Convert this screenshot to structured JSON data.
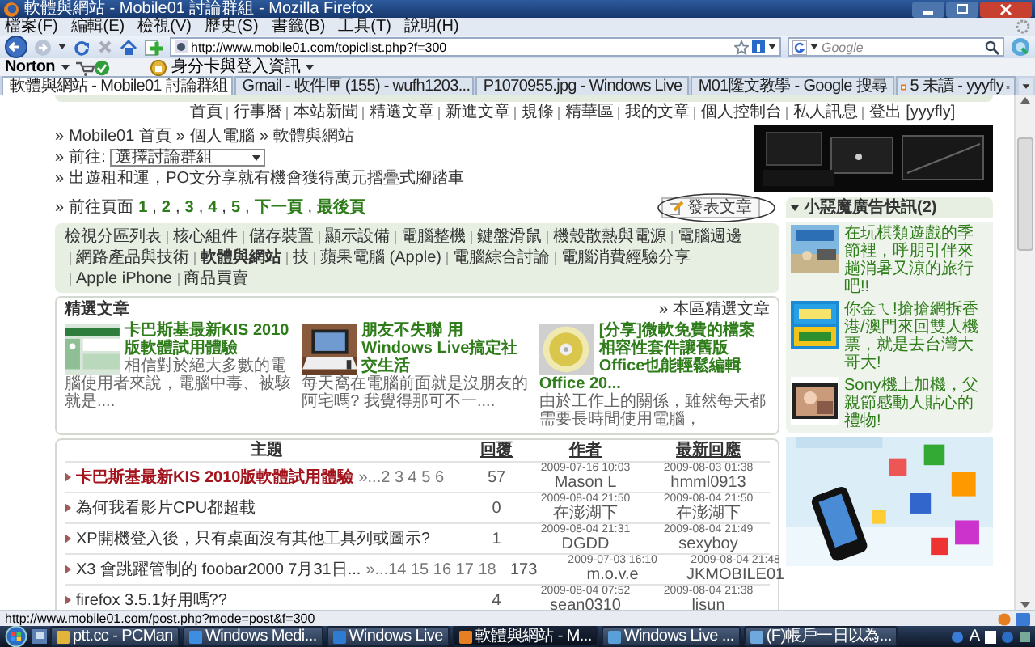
{
  "window": {
    "title": "軟體與網站 - Mobile01 討論群組 - Mozilla Firefox"
  },
  "menu": [
    "檔案(F)",
    "編輯(E)",
    "檢視(V)",
    "歷史(S)",
    "書籤(B)",
    "工具(T)",
    "說明(H)"
  ],
  "toolbar": {
    "url": "http://www.mobile01.com/topiclist.php?f=300",
    "search": {
      "placeholder": "Google"
    }
  },
  "norton_bar": {
    "brand": "Norton",
    "identity": "身分卡與登入資訊"
  },
  "tabs": [
    {
      "label": "軟體與網站 - Mobile01 討論群組",
      "selected": true
    },
    {
      "label": "Gmail - 收件匣 (155) - wufh1203...",
      "selected": false
    },
    {
      "label": "P1070955.jpg - Windows Live",
      "selected": false
    },
    {
      "label": "M01隆文教學 - Google 搜尋",
      "selected": false
    },
    {
      "label": "5 未讀 - yyyfly",
      "selected": false
    }
  ],
  "page": {
    "top_links": [
      "首頁",
      "行事曆",
      "本站新聞",
      "精選文章",
      "新進文章",
      "規條",
      "精華區",
      "我的文章",
      "個人控制台",
      "私人訊息",
      "登出 [yyyfly]"
    ],
    "bullet": "»",
    "breadcrumb": [
      "Mobile01 首頁",
      "個人電腦",
      "軟體與網站"
    ],
    "jump": {
      "label": "前往:",
      "value": "選擇討論群組"
    },
    "notice": "出遊租和運，PO文分享就有機會獲得萬元摺疊式腳踏車",
    "pager": {
      "label": "前往頁面",
      "separator": ",",
      "pages": [
        "1",
        "2",
        "3",
        "4",
        "5"
      ],
      "next": "下一頁",
      "last": "最後頁"
    },
    "post_button": "發表文章",
    "categories": [
      {
        "label": "檢視分區列表",
        "selected": false
      },
      {
        "label": "核心組件",
        "selected": false
      },
      {
        "label": "儲存裝置",
        "selected": false
      },
      {
        "label": "顯示設備",
        "selected": false
      },
      {
        "label": "電腦整機",
        "selected": false
      },
      {
        "label": "鍵盤滑鼠",
        "selected": false
      },
      {
        "label": "機殼散熱與電源",
        "selected": false
      },
      {
        "label": "電腦週邊",
        "selected": false
      },
      {
        "label": "網路產品與技術",
        "selected": false
      },
      {
        "label": "軟體與網站",
        "selected": true
      },
      {
        "label": "技",
        "selected": false
      },
      {
        "label": "蘋果電腦 (Apple)",
        "selected": false
      },
      {
        "label": "電腦綜合討論",
        "selected": false
      },
      {
        "label": "電腦消費經驗分享",
        "selected": false
      },
      {
        "label": "Apple iPhone",
        "selected": false
      },
      {
        "label": "商品買賣",
        "selected": false
      }
    ],
    "featured": {
      "title": "精選文章",
      "more": "本區精選文章",
      "articles": [
        {
          "title": "卡巴斯基最新KIS 2010 版軟體試用體驗",
          "summary": "相信對於絕大多數的電腦使用者來說，電腦中毒、被駭就是...."
        },
        {
          "title": "朋友不失聯 用Windows Live搞定社交生活",
          "summary": "每天窩在電腦前面就是沒朋友的阿宅嗎? 我覺得那可不一...."
        },
        {
          "title": "[分享]微軟免費的檔案相容性套件讓舊版Office也能輕鬆編輯Office 20...",
          "summary": "由於工作上的關係，雖然每天都需要長時間使用電腦，"
        }
      ]
    },
    "topics": {
      "columns": [
        "主題",
        "回覆",
        "作者",
        "最新回應"
      ],
      "rows": [
        {
          "title": "卡巴斯基最新KIS 2010版軟體試用體驗",
          "pages": "»...2 3 4 5 6",
          "hot": true,
          "replies": "57",
          "posted": "2009-07-16 10:03",
          "author": "Mason L",
          "last_time": "2009-08-03 01:38",
          "last_user": "hmml0913"
        },
        {
          "title": "為何我看影片CPU都超載",
          "hot": false,
          "replies": "0",
          "posted": "2009-08-04 21:50",
          "author": "在澎湖下",
          "last_time": "2009-08-04 21:50",
          "last_user": "在澎湖下"
        },
        {
          "title": "XP開機登入後，只有桌面沒有其他工具列或圖示?",
          "hot": false,
          "replies": "1",
          "posted": "2009-08-04 21:31",
          "author": "DGDD",
          "last_time": "2009-08-04 21:49",
          "last_user": "sexyboy"
        },
        {
          "title": "X3 會跳躍管制的 foobar2000 7月31日...",
          "pages": "»...14 15 16 17 18",
          "hot": false,
          "replies": "173",
          "posted": "2009-07-03 16:10",
          "author": "m.o.v.e",
          "last_time": "2009-08-04 21:48",
          "last_user": "JKMOBILE01"
        },
        {
          "title": "firefox 3.5.1好用嗎??",
          "hot": false,
          "replies": "4",
          "posted": "2009-08-04 07:52",
          "author": "sean0310",
          "last_time": "2009-08-04 21:38",
          "last_user": "lisun"
        }
      ]
    },
    "sidebar": {
      "title": "小惡魔廣告快訊(2)",
      "ads": [
        {
          "text": "在玩棋類遊戲的季節裡，呼朋引伴來趟消暑又涼的旅行吧!!"
        },
        {
          "text": "你金ㄟ!搶搶網拆香港/澳門來回雙人機票，就是去台灣大哥大!"
        },
        {
          "text": "Sony機上加機，父親節感動人貼心的禮物!"
        }
      ]
    }
  },
  "status_bar": "http://www.mobile01.com/post.php?mode=post&f=300",
  "taskbar": {
    "items": [
      {
        "label": "ptt.cc - PCMan",
        "selected": false
      },
      {
        "label": "Windows Medi...",
        "selected": false
      },
      {
        "label": "Windows Live",
        "selected": false
      },
      {
        "label": "軟體與網站 - M...",
        "selected": true
      },
      {
        "label": "Windows Live ...",
        "selected": false
      },
      {
        "label": "(F)帳戶一日以為...",
        "selected": false
      }
    ],
    "language": "A"
  }
}
